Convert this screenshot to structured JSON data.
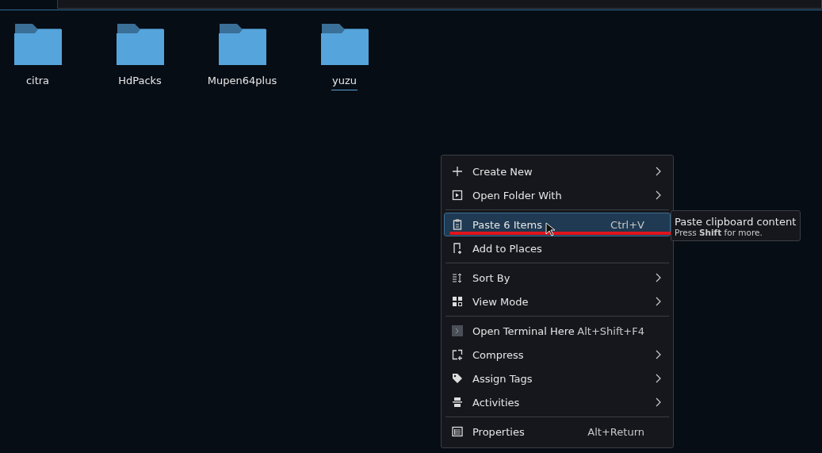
{
  "folders": [
    {
      "name": "citra",
      "selected": false
    },
    {
      "name": "HdPacks",
      "selected": false
    },
    {
      "name": "Mupen64plus",
      "selected": false
    },
    {
      "name": "yuzu",
      "selected": true
    }
  ],
  "context_menu": {
    "groups": [
      [
        {
          "label": "Create New",
          "submenu": true,
          "selected": false
        },
        {
          "label": "Open Folder With",
          "submenu": true,
          "selected": false
        }
      ],
      [
        {
          "label": "Paste 6 Items",
          "shortcut": "Ctrl+V",
          "submenu": false,
          "selected": true
        },
        {
          "label": "Add to Places",
          "submenu": false,
          "selected": false
        }
      ],
      [
        {
          "label": "Sort By",
          "submenu": true,
          "selected": false
        },
        {
          "label": "View Mode",
          "submenu": true,
          "selected": false
        }
      ],
      [
        {
          "label": "Open Terminal Here",
          "shortcut": "Alt+Shift+F4",
          "submenu": false,
          "selected": false
        },
        {
          "label": "Compress",
          "submenu": true,
          "selected": false
        },
        {
          "label": "Assign Tags",
          "submenu": true,
          "selected": false
        },
        {
          "label": "Activities",
          "submenu": true,
          "selected": false
        }
      ],
      [
        {
          "label": "Properties",
          "shortcut": "Alt+Return",
          "submenu": false,
          "selected": false
        }
      ]
    ]
  },
  "tooltip": {
    "title": "Paste clipboard content",
    "hint": "Press **Shift** for more."
  }
}
